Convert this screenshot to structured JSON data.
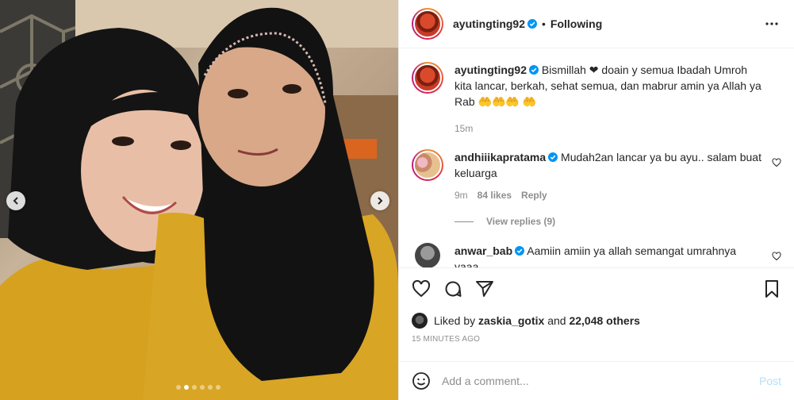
{
  "post": {
    "author": "ayutingting92",
    "follow_separator": "•",
    "follow_status": "Following",
    "caption": "Bismillah ❤ doain y semua Ibadah Umroh kita lancar, berkah, sehat semua, dan mabrur amin ya Allah ya Rab 🤲🤲🤲 🤲",
    "caption_age": "15m",
    "likes_prefix": "Liked by",
    "liked_by": "zaskia_gotix",
    "likes_and": "and",
    "likes_others": "22,048 others",
    "timestamp": "15 MINUTES AGO"
  },
  "comments": [
    {
      "user": "andhiiikapratama",
      "text": "Mudah2an lancar ya bu ayu.. salam buat keluarga",
      "age": "9m",
      "likes": "84 likes",
      "reply_label": "Reply",
      "view_replies": "View replies (9)"
    },
    {
      "user": "anwar_bab",
      "text": "Aamiin amiin ya allah semangat umrahnya yaaa"
    }
  ],
  "add_comment": {
    "placeholder": "Add a comment...",
    "post_label": "Post"
  },
  "carousel": {
    "total": 6,
    "active_index": 1
  },
  "colors": {
    "verified": "#0095f6",
    "post_disabled": "#b2dffc",
    "meta": "#8e8e8e"
  },
  "icons": [
    "chevron-left-icon",
    "chevron-right-icon",
    "more-icon",
    "verified-icon",
    "heart-icon",
    "comment-icon",
    "share-icon",
    "bookmark-icon",
    "emoji-icon"
  ]
}
